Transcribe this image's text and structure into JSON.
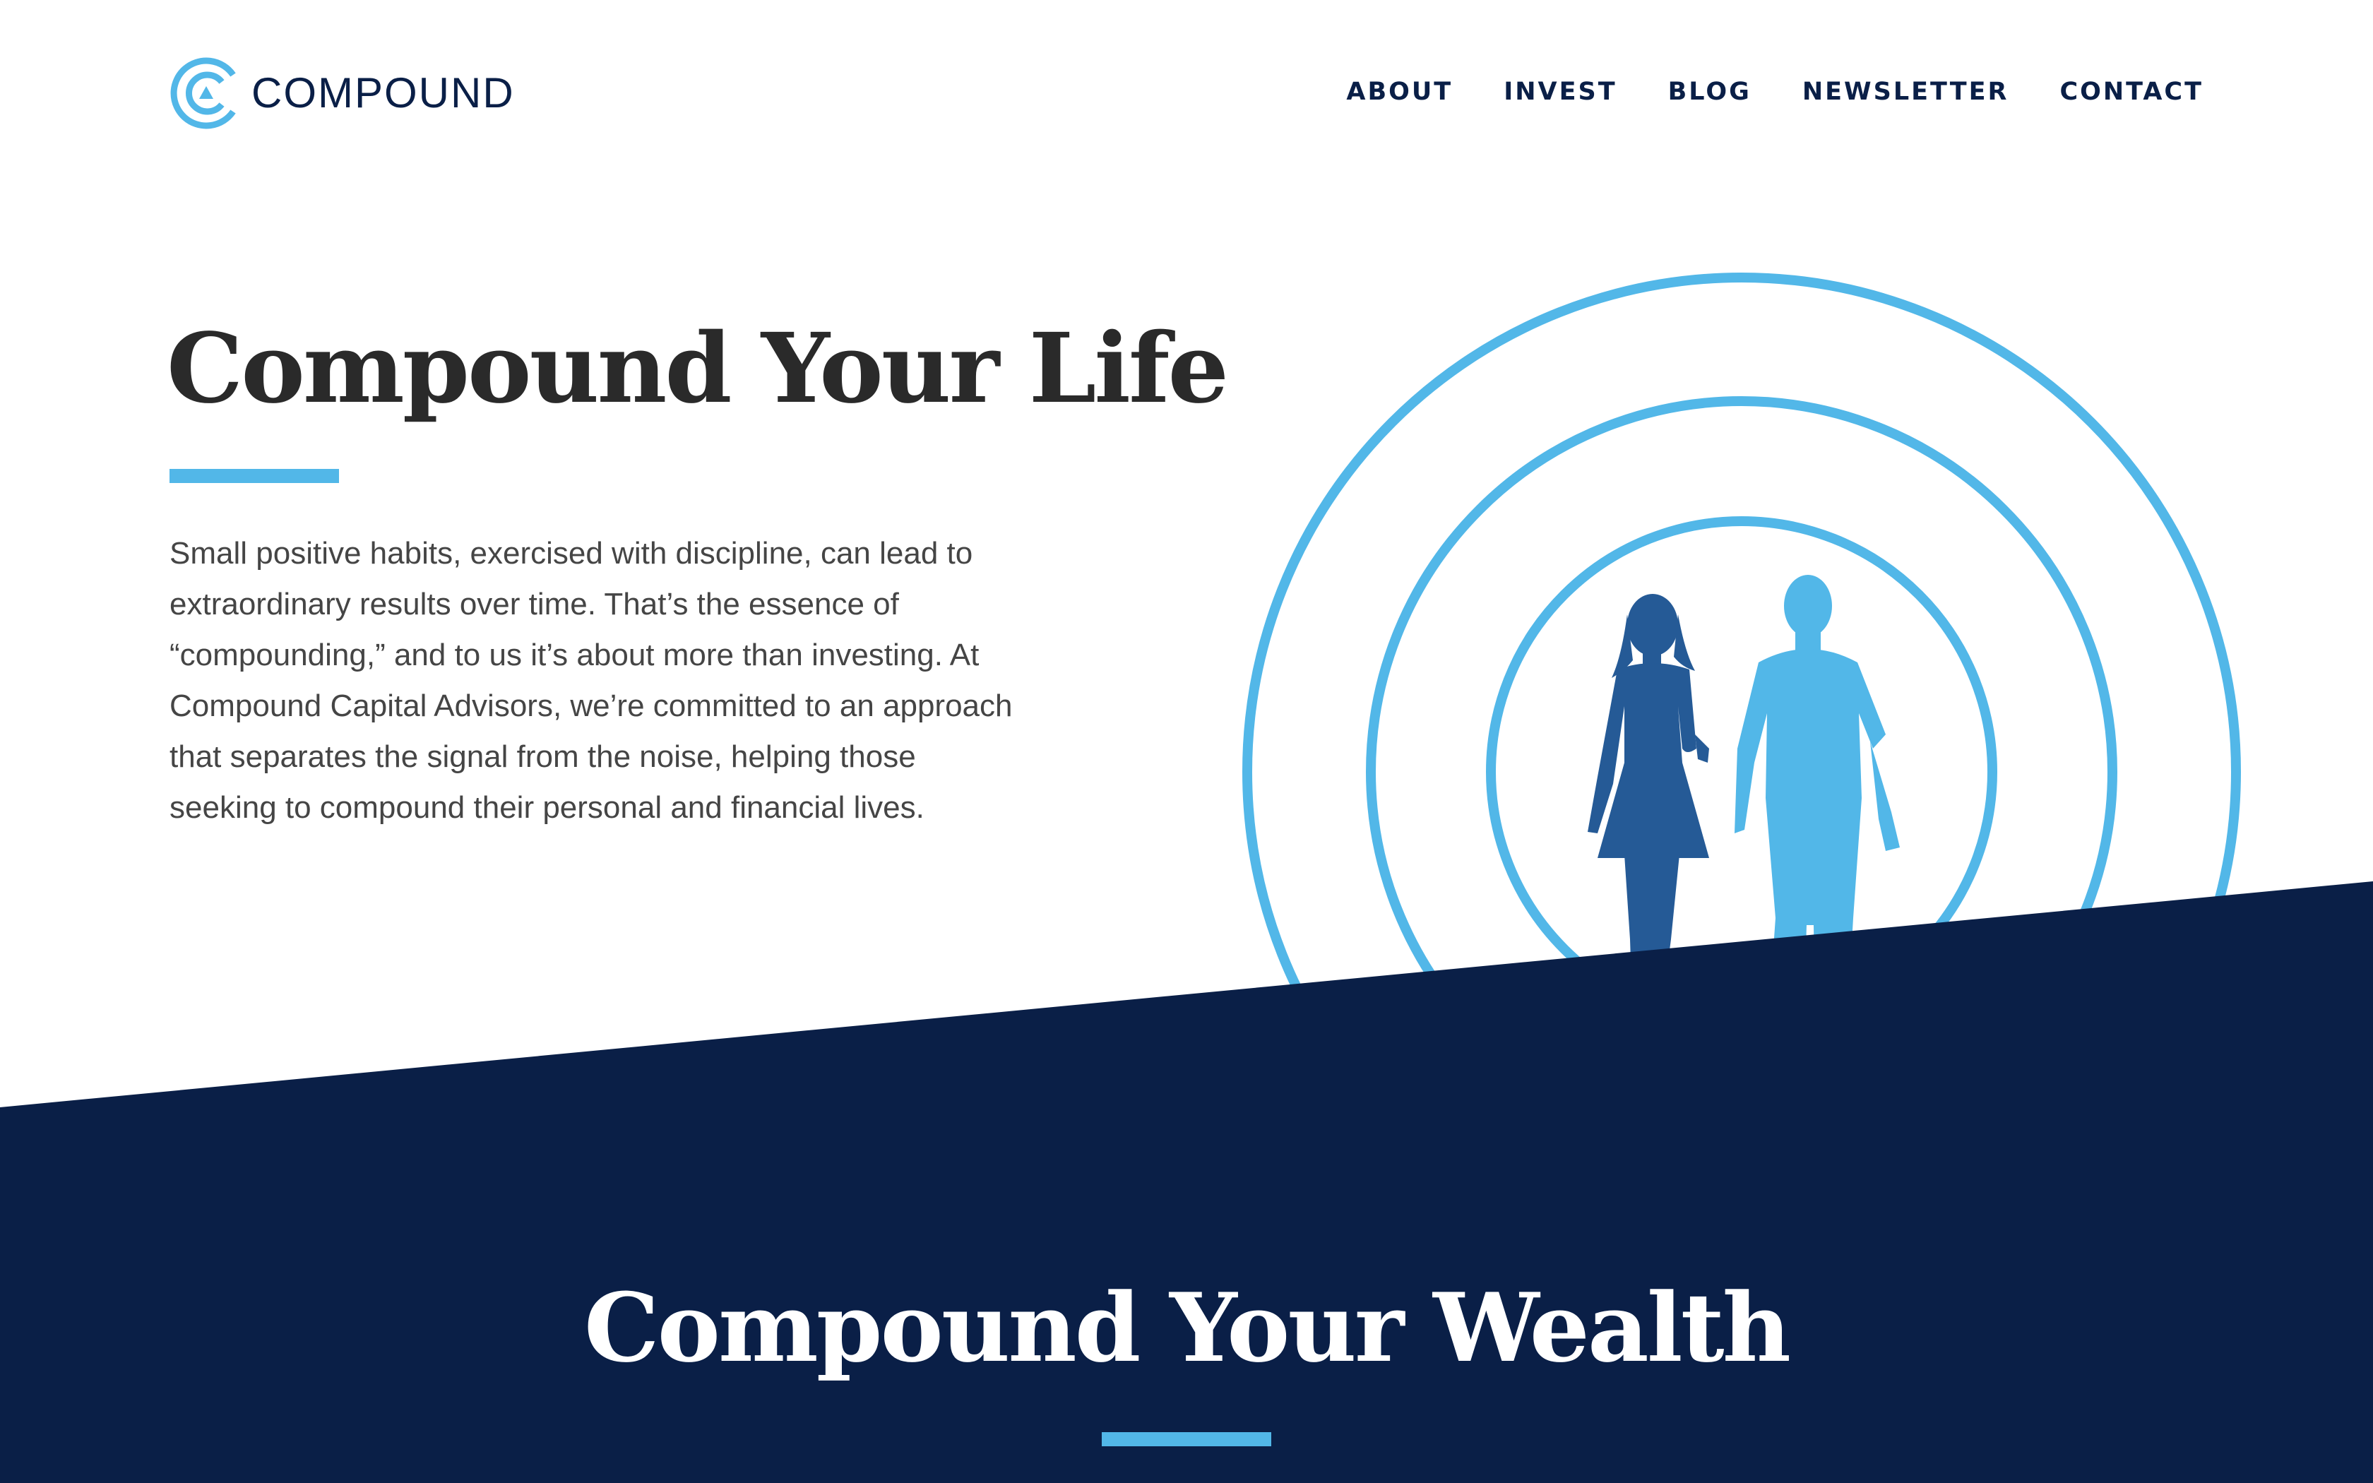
{
  "brand": {
    "name": "COMPOUND",
    "logo_icon": "compound-c-logo-icon"
  },
  "nav": {
    "items": [
      {
        "label": "ABOUT"
      },
      {
        "label": "INVEST"
      },
      {
        "label": "BLOG"
      },
      {
        "label": "NEWSLETTER"
      },
      {
        "label": "CONTACT"
      }
    ]
  },
  "hero": {
    "title": "Compound Your Life",
    "body": "Small positive habits, exercised with discipline, can lead to extraordinary results over time. That’s the essence of “compounding,” and to us it’s about more than investing. At Compound Capital Advisors, we’re committed to an approach that separates the signal from the noise, helping those seeking to compound their personal and financial lives.",
    "illustration": "concentric-circles-walking-couple-illustration"
  },
  "wealth_section": {
    "title": "Compound Your Wealth"
  },
  "colors": {
    "navy": "#0a1f47",
    "accent_blue": "#52b7e8",
    "woman_blue": "#255a96",
    "heading_dark": "#2a2a2a",
    "body_gray": "#454545"
  }
}
